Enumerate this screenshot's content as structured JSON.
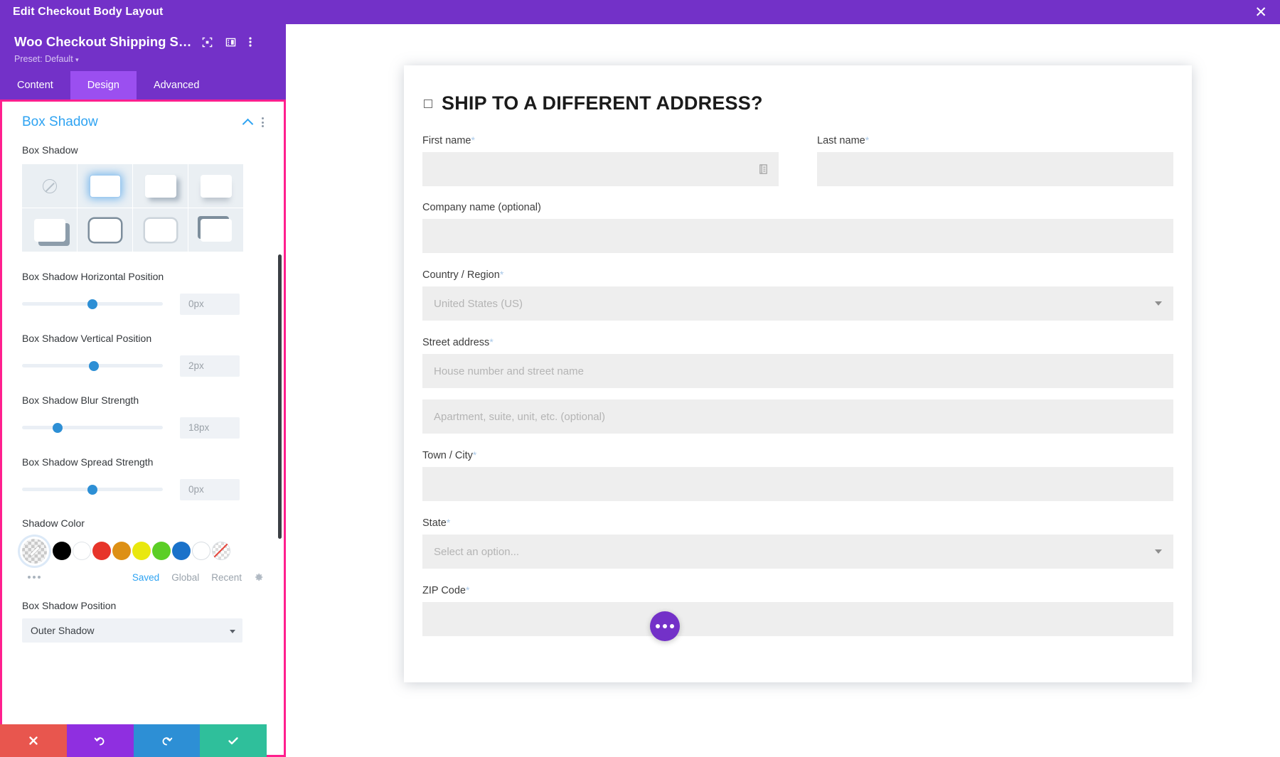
{
  "topbar": {
    "title": "Edit Checkout Body Layout",
    "close_label": "✕"
  },
  "panel": {
    "module_title": "Woo Checkout Shipping Set...",
    "preset_label": "Preset: Default",
    "preset_caret": "▾",
    "tabs": [
      {
        "label": "Content",
        "active": false
      },
      {
        "label": "Design",
        "active": true
      },
      {
        "label": "Advanced",
        "active": false
      }
    ],
    "section": {
      "title": "Box Shadow",
      "collapse_icon": "chevron-up-icon",
      "menu_icon": "kebab-menu-icon"
    },
    "box_shadow_label": "Box Shadow",
    "presets": [
      {
        "name": "none",
        "selected": false
      },
      {
        "name": "glow",
        "selected": true
      },
      {
        "name": "offset-bottom-right",
        "selected": false
      },
      {
        "name": "bottom-soft",
        "selected": false
      },
      {
        "name": "hard-offset",
        "selected": false
      },
      {
        "name": "outline",
        "selected": false
      },
      {
        "name": "inner",
        "selected": false
      },
      {
        "name": "top-left",
        "selected": false
      }
    ],
    "sliders": [
      {
        "label": "Box Shadow Horizontal Position",
        "value": "0px",
        "pos_pct": 50
      },
      {
        "label": "Box Shadow Vertical Position",
        "value": "2px",
        "pos_pct": 51
      },
      {
        "label": "Box Shadow Blur Strength",
        "value": "18px",
        "pos_pct": 25
      },
      {
        "label": "Box Shadow Spread Strength",
        "value": "0px",
        "pos_pct": 50
      }
    ],
    "shadow_color": {
      "label": "Shadow Color",
      "swatches": [
        {
          "name": "color-picker",
          "hex": "transparent"
        },
        {
          "name": "black",
          "hex": "#000000"
        },
        {
          "name": "white",
          "hex": "#ffffff"
        },
        {
          "name": "red",
          "hex": "#e7342a"
        },
        {
          "name": "orange",
          "hex": "#dd9015"
        },
        {
          "name": "yellow",
          "hex": "#e9e80e"
        },
        {
          "name": "green",
          "hex": "#5bce25"
        },
        {
          "name": "blue",
          "hex": "#1a72ca"
        },
        {
          "name": "white-outline",
          "hex": "#ffffff"
        },
        {
          "name": "transparent",
          "hex": "transparent"
        }
      ],
      "more_icon": "more-dots-icon",
      "links": [
        {
          "label": "Saved",
          "active": true
        },
        {
          "label": "Global",
          "active": false
        },
        {
          "label": "Recent",
          "active": false
        }
      ],
      "settings_icon": "gear-icon"
    },
    "position": {
      "label": "Box Shadow Position",
      "value": "Outer Shadow"
    }
  },
  "actions": [
    {
      "name": "cancel-button",
      "icon": "✕"
    },
    {
      "name": "undo-button",
      "icon": "↺"
    },
    {
      "name": "redo-button",
      "icon": "↻"
    },
    {
      "name": "save-button",
      "icon": "✓"
    }
  ],
  "checkout": {
    "heading": "SHIP TO A DIFFERENT ADDRESS?",
    "fields": {
      "first_name": {
        "label": "First name",
        "required": "*",
        "placeholder": "",
        "value": ""
      },
      "last_name": {
        "label": "Last name",
        "required": "*",
        "placeholder": "",
        "value": ""
      },
      "company": {
        "label": "Company name (optional)",
        "required": "",
        "placeholder": "",
        "value": ""
      },
      "country": {
        "label": "Country / Region",
        "required": "*",
        "placeholder": "United States (US)",
        "value": ""
      },
      "street": {
        "label": "Street address",
        "required": "*",
        "placeholder": "House number and street name",
        "value": ""
      },
      "street2": {
        "label": "",
        "required": "",
        "placeholder": "Apartment, suite, unit, etc. (optional)",
        "value": ""
      },
      "city": {
        "label": "Town / City",
        "required": "*",
        "placeholder": "",
        "value": ""
      },
      "state": {
        "label": "State",
        "required": "*",
        "placeholder": "Select an option...",
        "value": ""
      },
      "zip": {
        "label": "ZIP Code",
        "required": "*",
        "placeholder": "",
        "value": ""
      }
    },
    "fab_icon": "more-options-icon"
  }
}
